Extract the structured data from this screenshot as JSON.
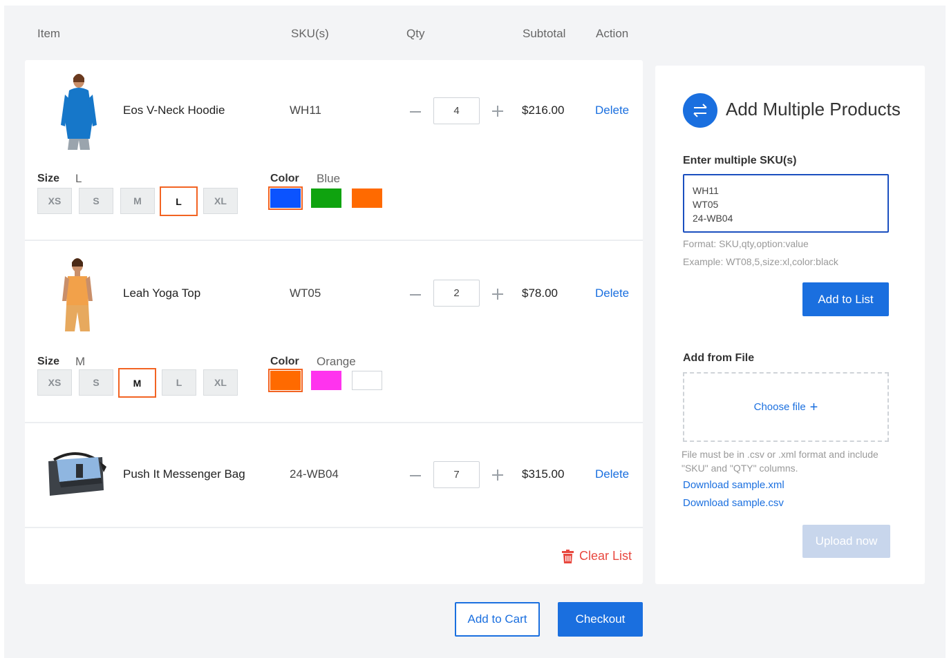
{
  "columns": {
    "item": "Item",
    "skus": "SKU(s)",
    "qty": "Qty",
    "subtotal": "Subtotal",
    "action": "Action"
  },
  "rows": [
    {
      "name": "Eos V-Neck Hoodie",
      "sku": "WH11",
      "qty": "4",
      "subtotal": "$216.00",
      "delete_label": "Delete",
      "image": "blue-hoodie-product-photo",
      "size_label": "Size",
      "size_value": "L",
      "sizes": [
        "XS",
        "S",
        "M",
        "L",
        "XL"
      ],
      "selected_size": "L",
      "color_label": "Color",
      "color_value": "Blue",
      "colors": [
        "#0b53ff",
        "#0fa30f",
        "#ff6a00"
      ],
      "selected_color": "#0b53ff"
    },
    {
      "name": "Leah Yoga Top",
      "sku": "WT05",
      "qty": "2",
      "subtotal": "$78.00",
      "delete_label": "Delete",
      "image": "orange-yoga-top-product-photo",
      "size_label": "Size",
      "size_value": "M",
      "sizes": [
        "XS",
        "S",
        "M",
        "L",
        "XL"
      ],
      "selected_size": "M",
      "color_label": "Color",
      "color_value": "Orange",
      "colors": [
        "#ff6a00",
        "#ff33ee",
        "#ffffff"
      ],
      "selected_color": "#ff6a00"
    },
    {
      "name": "Push It Messenger Bag",
      "sku": "24-WB04",
      "qty": "7",
      "subtotal": "$315.00",
      "delete_label": "Delete",
      "image": "messenger-bag-product-photo"
    }
  ],
  "clear_list": "Clear List",
  "add_to_cart": "Add to Cart",
  "checkout": "Checkout",
  "sidebar": {
    "title": "Add Multiple Products",
    "icon": "swap-arrows-icon",
    "sku_label": "Enter multiple SKU(s)",
    "sku_value": "WH11\nWT05\n24-WB04",
    "format_hint": "Format: SKU,qty,option:value",
    "example_hint": "Example: WT08,5,size:xl,color:black",
    "add_to_list": "Add to List",
    "file_label": "Add from File",
    "choose_file": "Choose file",
    "file_note": "File must be in .csv or .xml format and include \"SKU\" and \"QTY\" columns.",
    "download_xml": "Download sample.xml",
    "download_csv": "Download sample.csv",
    "upload_now": "Upload now"
  },
  "colors": {
    "accent": "#1a6fdf",
    "selected_border": "#f26322",
    "danger": "#e8483f"
  }
}
